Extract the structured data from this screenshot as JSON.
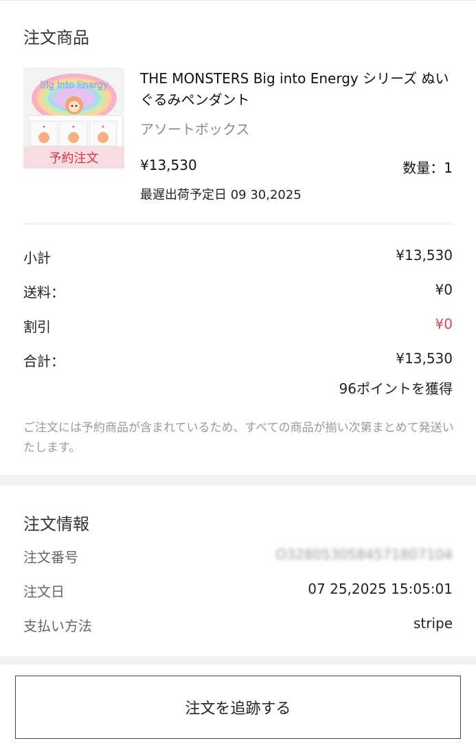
{
  "order_items": {
    "title": "注文商品",
    "product": {
      "name": "THE MONSTERS Big into Energy シリーズ ぬいぐるみペンダント",
      "variant": "アソートボックス",
      "price": "¥13,530",
      "quantity": "数量：1",
      "preorder_badge": "予約注文",
      "ship_date": "最遅出荷予定日 09 30,2025",
      "image_text": "Big into Energy"
    },
    "summary": [
      {
        "label": "小計",
        "value": "¥13,530"
      },
      {
        "label": "送料：",
        "value": "¥0"
      },
      {
        "label": "割引",
        "value": "¥0"
      },
      {
        "label": "合計：",
        "value": "¥13,530"
      }
    ],
    "points": "96ポイントを獲得",
    "notice": "ご注文には予約商品が含まれているため、すべての商品が揃い次第まとめて発送いたします。",
    "discount_color": "#e2445c"
  },
  "order_info": {
    "title": "注文情報",
    "rows": [
      {
        "label": "注文番号",
        "value": "O32805305845718071​04"
      },
      {
        "label": "注文日",
        "value": "07 25,2025 15:05:01"
      },
      {
        "label": "支払い方法",
        "value": "stripe"
      }
    ]
  },
  "actions": {
    "track_label": "注文を追跡する"
  }
}
